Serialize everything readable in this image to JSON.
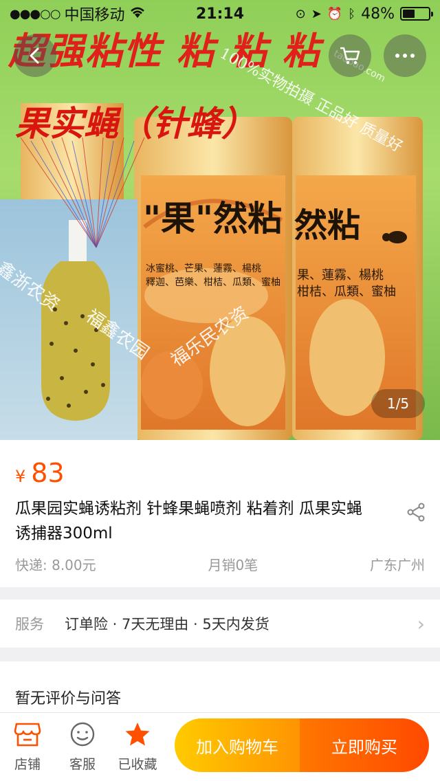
{
  "status_bar": {
    "carrier": "中国移动",
    "time": "21:14",
    "battery": "48%",
    "battery_level": 0.48
  },
  "gallery": {
    "banner_line_1": "超强粘性 粘 粘 粘",
    "banner_line_2": "果实蝇（针蜂）",
    "watermark_1": "100%实物拍摄 正品好 质量好",
    "watermark_2": "taobao.com",
    "can_brand": "\"果\"然粘",
    "can_brand_2": "然粘",
    "can_fruits_1": "冰蜜桃、芒果、蓮霧、楊桃",
    "can_fruits_2": "釋迦、芭樂、柑桔、瓜類、蜜柚",
    "can_fruits_3": "果、蓮霧、楊桃",
    "can_fruits_4": "柑桔、瓜類、蜜柚",
    "shop_mark_1": "鑫浙农资",
    "shop_mark_2": "福鑫农园",
    "shop_mark_3": "福乐民农资",
    "page_indicator": "1/5"
  },
  "product": {
    "price_symbol": "¥",
    "price": "83",
    "title": "瓜果园实蝇诱粘剂 针蜂果蝇喷剂 粘着剂 瓜果实蝇诱捕器300ml",
    "shipping": "快递: 8.00元",
    "monthly_sales": "月销0笔",
    "location": "广东广州"
  },
  "service": {
    "label": "服务",
    "text": "订单险 · 7天无理由 · 5天内发货"
  },
  "reviews": {
    "title": "暂无评价与问答"
  },
  "bottom_bar": {
    "shop_label": "店铺",
    "service_label": "客服",
    "favorite_label": "已收藏",
    "add_to_cart": "加入购物车",
    "buy_now": "立即购买"
  },
  "colors": {
    "accent": "#ff5000",
    "cart_button": "#ffa800",
    "buy_button": "#ff5a00"
  },
  "icons": [
    "back-icon",
    "cart-icon",
    "more-icon",
    "share-icon",
    "chevron-right-icon",
    "shop-icon",
    "customer-service-icon",
    "star-icon",
    "wifi-icon",
    "battery-icon"
  ]
}
